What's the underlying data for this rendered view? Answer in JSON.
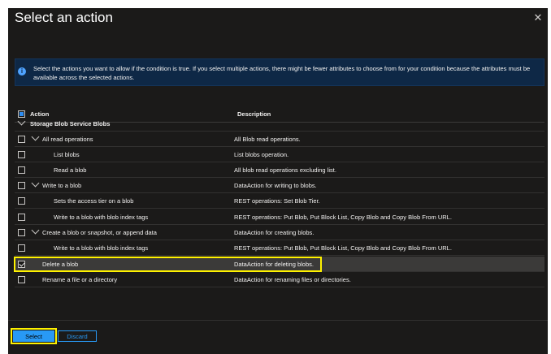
{
  "header": {
    "title": "Select an action",
    "close_icon": "close-icon"
  },
  "info": {
    "icon": "info-icon",
    "text": "Select the actions you want to allow if the condition is true. If you select multiple actions, there might be fewer attributes to choose from for your condition because the attributes must be available across the selected actions."
  },
  "grid": {
    "col_action": "Action",
    "col_description": "Description",
    "group": "Storage Blob Service Blobs",
    "rows": [
      {
        "action": "All read operations",
        "description": "All Blob read operations.",
        "checked": false
      },
      {
        "action": "List blobs",
        "description": "List blobs operation.",
        "checked": false
      },
      {
        "action": "Read a blob",
        "description": "All blob read operations excluding list.",
        "checked": false
      },
      {
        "action": "Write to a blob",
        "description": "DataAction for writing to blobs.",
        "checked": false
      },
      {
        "action": "Sets the access tier on a blob",
        "description": "REST operations: Set Blob Tier.",
        "checked": false
      },
      {
        "action": "Write to a blob with blob index tags",
        "description": "REST operations: Put Blob, Put Block List, Copy Blob and Copy Blob From URL.",
        "checked": false
      },
      {
        "action": "Create a blob or snapshot, or append data",
        "description": "DataAction for creating blobs.",
        "checked": false
      },
      {
        "action": "Write to a blob with blob index tags",
        "description": "REST operations: Put Blob, Put Block List, Copy Blob and Copy Blob From URL.",
        "checked": false
      },
      {
        "action": "Delete a blob",
        "description": "DataAction for deleting blobs.",
        "checked": true
      },
      {
        "action": "Rename a file or a directory",
        "description": "DataAction for renaming files or directories.",
        "checked": false
      }
    ]
  },
  "footer": {
    "select_label": "Select",
    "discard_label": "Discard"
  },
  "colors": {
    "accent": "#2899f5",
    "highlight": "#fff200",
    "panel_bg": "#1b1a19"
  }
}
